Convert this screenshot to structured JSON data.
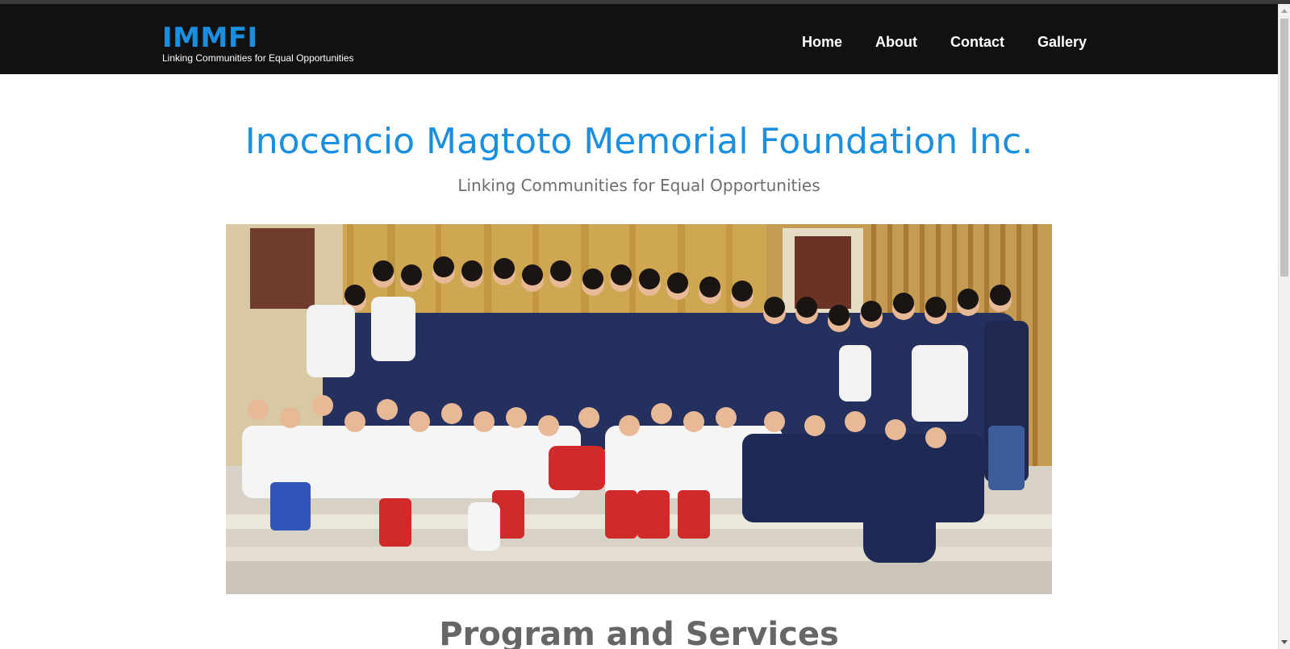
{
  "navbar": {
    "brand": "IMMFI",
    "tagline": "Linking Communities for Equal Opportunities",
    "links": [
      "Home",
      "About",
      "Contact",
      "Gallery"
    ]
  },
  "hero": {
    "title": "Inocencio Magtoto Memorial Foundation Inc.",
    "subtitle": "Linking Communities for Equal Opportunities"
  },
  "photo": {
    "alt": "Group photo of children and volunteers"
  },
  "section": {
    "title": "Program and Services"
  },
  "colors": {
    "accent": "#1a8fe0",
    "navbar_bg": "#111111",
    "muted_text": "#6d6d6d"
  }
}
